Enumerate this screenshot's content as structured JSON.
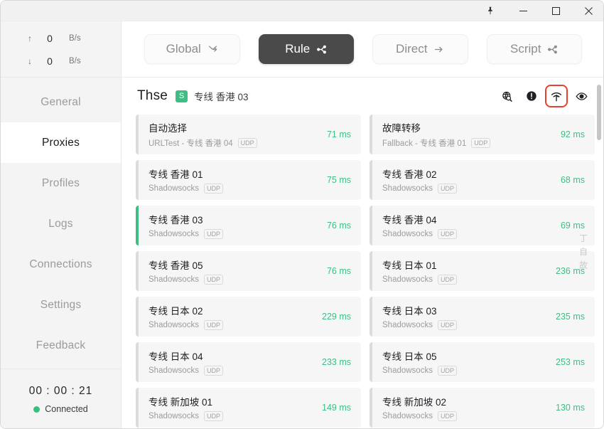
{
  "window": {
    "controls": [
      {
        "name": "pin-button",
        "label": "Pin"
      },
      {
        "name": "minimize-button",
        "label": "Minimize"
      },
      {
        "name": "maximize-button",
        "label": "Maximize"
      },
      {
        "name": "close-button",
        "label": "Close"
      }
    ]
  },
  "sidebar": {
    "speed": {
      "upload": {
        "arrow": "↑",
        "value": "0",
        "unit": "B/s"
      },
      "download": {
        "arrow": "↓",
        "value": "0",
        "unit": "B/s"
      }
    },
    "items": [
      {
        "label": "General",
        "active": false
      },
      {
        "label": "Proxies",
        "active": true
      },
      {
        "label": "Profiles",
        "active": false
      },
      {
        "label": "Logs",
        "active": false
      },
      {
        "label": "Connections",
        "active": false
      },
      {
        "label": "Settings",
        "active": false
      },
      {
        "label": "Feedback",
        "active": false
      }
    ],
    "footer": {
      "timer": "00 : 00 : 21",
      "status": "Connected",
      "status_color": "#35c07f"
    }
  },
  "modebar": {
    "modes": [
      {
        "label": "Global",
        "icon": "merge-arrow-icon",
        "active": false
      },
      {
        "label": "Rule",
        "icon": "branch-share-icon",
        "active": true
      },
      {
        "label": "Direct",
        "icon": "arrow-right-icon",
        "active": false
      },
      {
        "label": "Script",
        "icon": "branch-share-icon",
        "active": false
      }
    ]
  },
  "group": {
    "title": "Thse",
    "badge": "S",
    "badge_color": "#3fbd85",
    "subtitle": "专线 香港 03",
    "actions": [
      {
        "name": "globe-search-icon",
        "label": "Test URL",
        "highlighted": false
      },
      {
        "name": "alert-circle-icon",
        "label": "Alerts",
        "highlighted": false
      },
      {
        "name": "speed-test-icon",
        "label": "Speed Test",
        "highlighted": true
      },
      {
        "name": "eye-icon",
        "label": "Toggle Visibility",
        "highlighted": false
      }
    ],
    "highlight_color": "#e8402f"
  },
  "proxies": [
    {
      "name": "自动选择",
      "type": "URLTest - 专线 香港 04",
      "udp": "UDP",
      "latency": "71 ms",
      "selected": false
    },
    {
      "name": "故障转移",
      "type": "Fallback - 专线 香港 01",
      "udp": "UDP",
      "latency": "92 ms",
      "selected": false
    },
    {
      "name": "专线 香港 01",
      "type": "Shadowsocks",
      "udp": "UDP",
      "latency": "75 ms",
      "selected": false
    },
    {
      "name": "专线 香港 02",
      "type": "Shadowsocks",
      "udp": "UDP",
      "latency": "68 ms",
      "selected": false
    },
    {
      "name": "专线 香港 03",
      "type": "Shadowsocks",
      "udp": "UDP",
      "latency": "76 ms",
      "selected": true
    },
    {
      "name": "专线 香港 04",
      "type": "Shadowsocks",
      "udp": "UDP",
      "latency": "69 ms",
      "selected": false
    },
    {
      "name": "专线 香港 05",
      "type": "Shadowsocks",
      "udp": "UDP",
      "latency": "76 ms",
      "selected": false
    },
    {
      "name": "专线 日本 01",
      "type": "Shadowsocks",
      "udp": "UDP",
      "latency": "236 ms",
      "selected": false
    },
    {
      "name": "专线 日本 02",
      "type": "Shadowsocks",
      "udp": "UDP",
      "latency": "229 ms",
      "selected": false
    },
    {
      "name": "专线 日本 03",
      "type": "Shadowsocks",
      "udp": "UDP",
      "latency": "235 ms",
      "selected": false
    },
    {
      "name": "专线 日本 04",
      "type": "Shadowsocks",
      "udp": "UDP",
      "latency": "233 ms",
      "selected": false
    },
    {
      "name": "专线 日本 05",
      "type": "Shadowsocks",
      "udp": "UDP",
      "latency": "253 ms",
      "selected": false
    },
    {
      "name": "专线 新加坡 01",
      "type": "Shadowsocks",
      "udp": "UDP",
      "latency": "149 ms",
      "selected": false
    },
    {
      "name": "专线 新加坡 02",
      "type": "Shadowsocks",
      "udp": "UDP",
      "latency": "130 ms",
      "selected": false
    }
  ],
  "overlay": {
    "ghost_vertical_text": "丁自故"
  }
}
